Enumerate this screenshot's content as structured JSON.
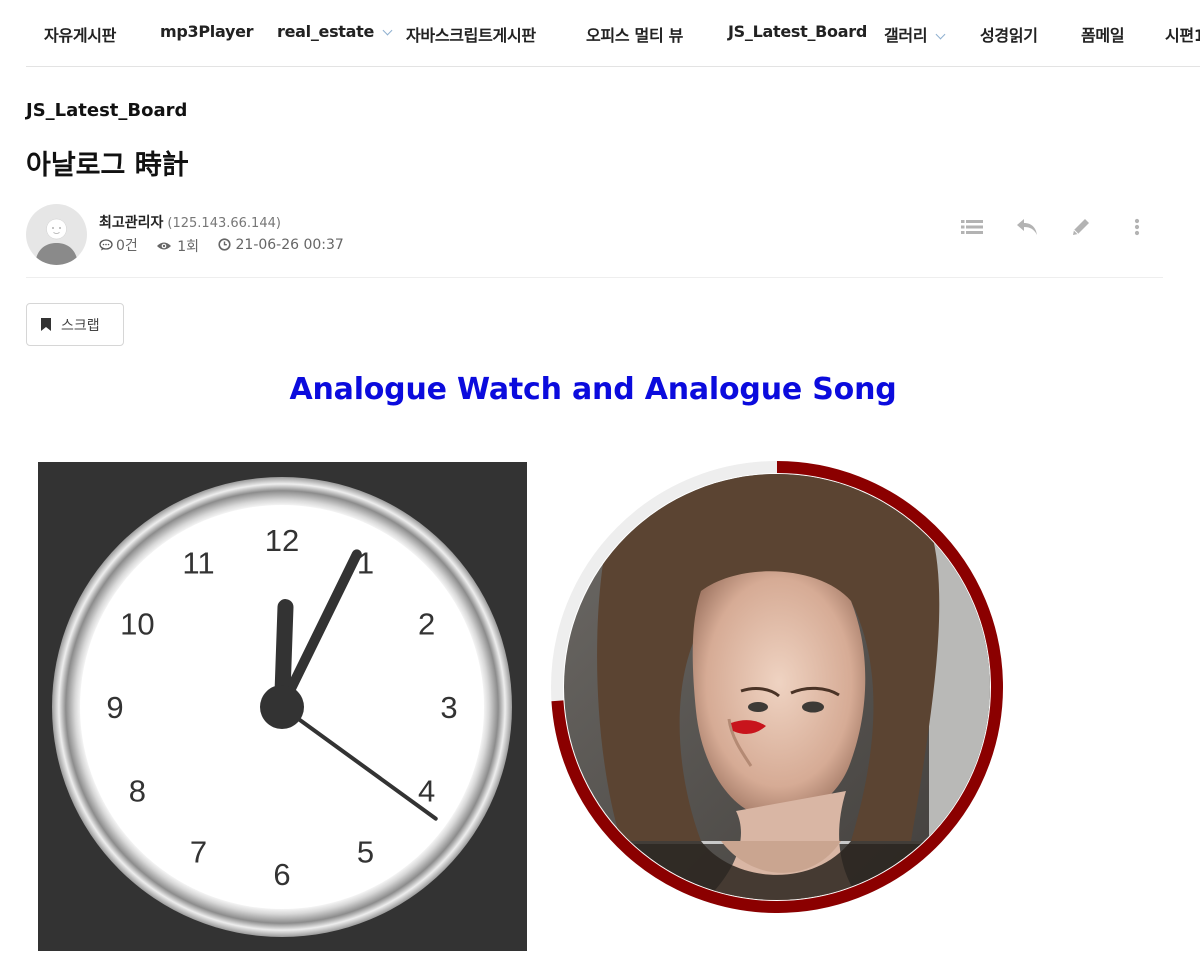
{
  "nav": {
    "items": [
      {
        "label": "자유게시판",
        "dropdown": false
      },
      {
        "label": "mp3Player",
        "dropdown": false
      },
      {
        "label": "real_estate",
        "dropdown": true
      },
      {
        "label": "자바스크립트게시판",
        "dropdown": false
      },
      {
        "label": "오피스 멀티 뷰",
        "dropdown": false
      },
      {
        "label": "JS_Latest_Board",
        "dropdown": false
      },
      {
        "label": "갤러리",
        "dropdown": true
      },
      {
        "label": "성경읽기",
        "dropdown": false
      },
      {
        "label": "폼메일",
        "dropdown": false
      },
      {
        "label": "시편1",
        "dropdown": false
      }
    ]
  },
  "post": {
    "board_name": "JS_Latest_Board",
    "title": "아날로그 時計",
    "author": "최고관리자",
    "author_ip": "(125.143.66.144)",
    "comments": "0건",
    "views": "1회",
    "date": "21-06-26 00:37"
  },
  "actions": {
    "list_icon": "list-icon",
    "reply_icon": "reply-icon",
    "edit_icon": "pencil-icon",
    "more_icon": "more-vertical-icon"
  },
  "scrap": {
    "label": "스크랩"
  },
  "content": {
    "heading": "Analogue Watch and Analogue Song",
    "heading_color": "#0b0bdd"
  },
  "clock": {
    "numbers": [
      "12",
      "1",
      "2",
      "3",
      "4",
      "5",
      "6",
      "7",
      "8",
      "9",
      "10",
      "11"
    ],
    "hour": 12,
    "minute": 4,
    "second": 21
  },
  "song": {
    "progress": 0.74,
    "progress_color": "#8b0000",
    "track_color": "#eeeeee"
  }
}
